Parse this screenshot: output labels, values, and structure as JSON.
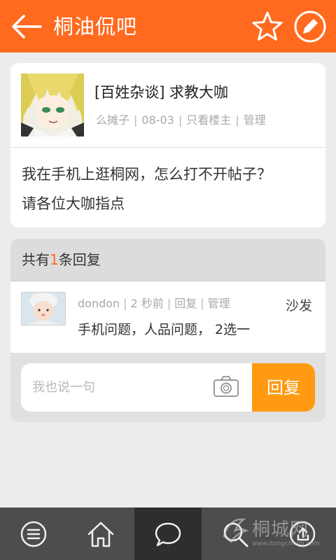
{
  "header": {
    "title": "桐油侃吧"
  },
  "post": {
    "title": "[百姓杂谈] 求教大咖",
    "author": "么摊子",
    "date": "08-03",
    "only_owner": "只看楼主",
    "manage": "管理",
    "body_line1": "我在手机上逛桐网，怎么打不开帖子？",
    "body_line2": "请各位大咖指点"
  },
  "replies_header": {
    "prefix": "共有",
    "count": "1",
    "suffix": "条回复"
  },
  "reply": {
    "user": "dondon",
    "time": "2 秒前",
    "reply_label": "回复",
    "manage": "管理",
    "floor": "沙发",
    "text": "手机问题，人品问题，  2选一"
  },
  "reply_box": {
    "placeholder": "我也说一句",
    "submit": "回复"
  },
  "watermark": {
    "text": "桐城网",
    "url": "www.itongcheng.com"
  },
  "colors": {
    "brand": "#ff6a1f",
    "submit": "#ff9a12",
    "nav_bg": "#4d4d4d"
  },
  "icons": {
    "back": "arrow-left-icon",
    "favorite": "star-icon",
    "edit": "pencil-icon",
    "camera": "camera-icon",
    "menu": "menu-icon",
    "home": "home-icon",
    "chat": "chat-bubble-icon",
    "search": "search-icon",
    "share": "share-icon"
  }
}
